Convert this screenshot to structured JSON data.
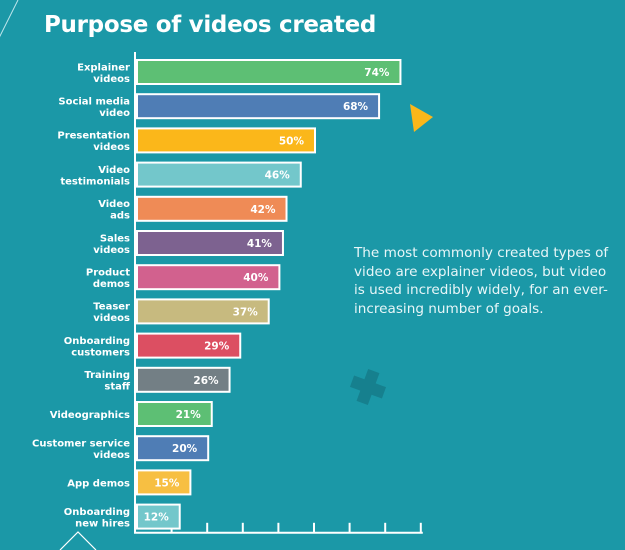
{
  "title": "Purpose of videos created",
  "caption": "The most commonly created types of video are explainer videos, but video is used incredibly widely, for an ever-increasing number of goals.",
  "colors": {
    "background": "#1b98a7",
    "axis": "#ffffff",
    "decor_triangle": "#fbb71a",
    "decor_cross": "#16808e"
  },
  "chart_data": {
    "type": "bar",
    "orientation": "horizontal",
    "title": "Purpose of videos created",
    "xlabel": "",
    "ylabel": "",
    "xlim": [
      0,
      80
    ],
    "grid": false,
    "value_format": "percent",
    "categories": [
      [
        "Explainer",
        "videos"
      ],
      [
        "Social media",
        "video"
      ],
      [
        "Presentation",
        "videos"
      ],
      [
        "Video",
        "testimonials"
      ],
      [
        "Video",
        "ads"
      ],
      [
        "Sales",
        "videos"
      ],
      [
        "Product",
        "demos"
      ],
      [
        "Teaser",
        "videos"
      ],
      [
        "Onboarding",
        "customers"
      ],
      [
        "Training",
        "staff"
      ],
      [
        "Videographics"
      ],
      [
        "Customer service",
        "videos"
      ],
      [
        "App demos"
      ],
      [
        "Onboarding",
        "new hires"
      ]
    ],
    "values": [
      74,
      68,
      50,
      46,
      42,
      41,
      40,
      37,
      29,
      26,
      21,
      20,
      15,
      12
    ],
    "data_labels": [
      "74%",
      "68%",
      "50%",
      "46%",
      "42%",
      "41%",
      "40%",
      "37%",
      "29%",
      "26%",
      "21%",
      "20%",
      "15%",
      "12%"
    ],
    "bar_colors": [
      "#5dbf74",
      "#4f7db5",
      "#fbb71a",
      "#73c7cb",
      "#ef8b56",
      "#7d6290",
      "#d2618e",
      "#c7ba7f",
      "#dc4f62",
      "#737f85",
      "#5dbf74",
      "#4f7db5",
      "#f7bf42",
      "#73c7cb"
    ],
    "x_ticks": [
      10,
      20,
      30,
      40,
      50,
      60,
      70,
      80
    ]
  }
}
